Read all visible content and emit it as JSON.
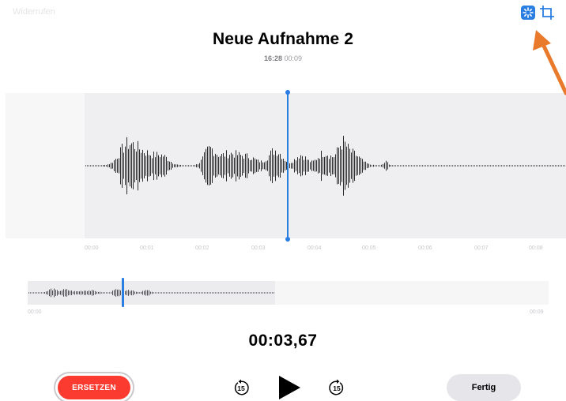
{
  "toolbar": {
    "undo_label": "Widerrufen",
    "enhance_icon": "magic-wand-icon",
    "crop_icon": "crop-icon",
    "accent_color": "#2a7de1"
  },
  "recording": {
    "title": "Neue Aufnahme 2",
    "time_of_day": "16:28",
    "duration": "00:09"
  },
  "timeline": {
    "ticks": [
      "00:00",
      "00:01",
      "00:02",
      "00:03",
      "00:04",
      "00:05",
      "00:06",
      "00:07",
      "00:08"
    ]
  },
  "overview": {
    "start_label": "00:00",
    "end_label": "00:09"
  },
  "playback": {
    "current_time": "00:03,67",
    "skip_back_label": "15",
    "skip_forward_label": "15"
  },
  "actions": {
    "replace_label": "ERSETZEN",
    "done_label": "Fertig",
    "replace_color": "#fb3a30"
  },
  "annotation": {
    "arrow_color": "#e97a2b"
  }
}
